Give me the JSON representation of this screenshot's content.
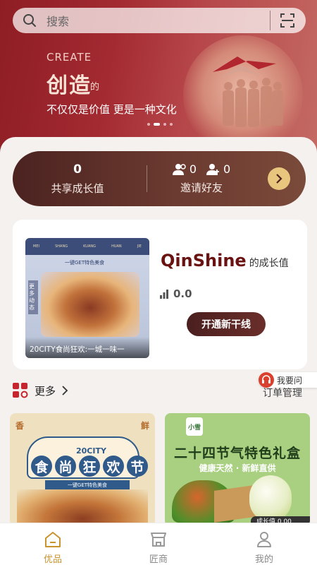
{
  "search": {
    "placeholder": "搜索"
  },
  "banner": {
    "en": "CREATE",
    "cn": "创造",
    "de": "的",
    "subtitle": "不仅仅是价值 更是一种文化",
    "active_dot": 1
  },
  "growth_bar": {
    "shared_value": "0",
    "shared_label": "共享成长值",
    "friends_count_a": "0",
    "friends_count_b": "0",
    "invite_label": "邀请好友"
  },
  "member_card": {
    "promo_caption": "20CITY食尚狂欢:一城一味一",
    "promo_side": "更多动态",
    "promo_banner": "一键GET特色美食",
    "brand": "QinShine",
    "brand_suffix": "的成长值",
    "growth_value": "0.0",
    "open_button": "开通新干线"
  },
  "more_row": {
    "more_label": "更多",
    "order_label": "订单管理",
    "ask_label": "我要问"
  },
  "products": [
    {
      "corner_left": "香",
      "corner_right": "鲜",
      "sub": "20CITY",
      "title_chars": [
        "食",
        "尚",
        "狂",
        "欢",
        "节"
      ],
      "strip": "一键GET特色美食"
    },
    {
      "logo": "小雪",
      "title": "二十四节气特色礼盒",
      "subtitle": "健康天然 · 新鲜直供",
      "tag": "成长值 0.00"
    }
  ],
  "tabs": [
    {
      "label": "优品",
      "active": true
    },
    {
      "label": "匠商",
      "active": false
    },
    {
      "label": "我的",
      "active": false
    }
  ],
  "colors": {
    "accent": "#c9932e",
    "banner": "#a32a31",
    "brand": "#6a1212"
  }
}
